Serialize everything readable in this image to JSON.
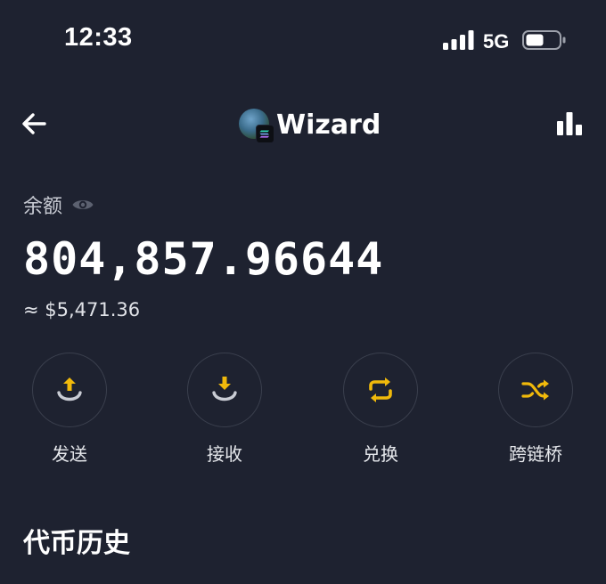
{
  "status_bar": {
    "time": "12:33",
    "network": "5G"
  },
  "header": {
    "wallet_name": "Wizard"
  },
  "balance": {
    "label": "余额",
    "amount": "804,857.96644",
    "fiat_value": "≈ $5,471.36"
  },
  "actions": [
    {
      "label": "发送",
      "icon": "send-icon"
    },
    {
      "label": "接收",
      "icon": "receive-icon"
    },
    {
      "label": "兑换",
      "icon": "swap-icon"
    },
    {
      "label": "跨链桥",
      "icon": "bridge-icon"
    }
  ],
  "section": {
    "title": "代币历史"
  },
  "colors": {
    "background": "#1e2230",
    "accent": "#f0b90b",
    "icon_grey": "#c9ccd4"
  }
}
